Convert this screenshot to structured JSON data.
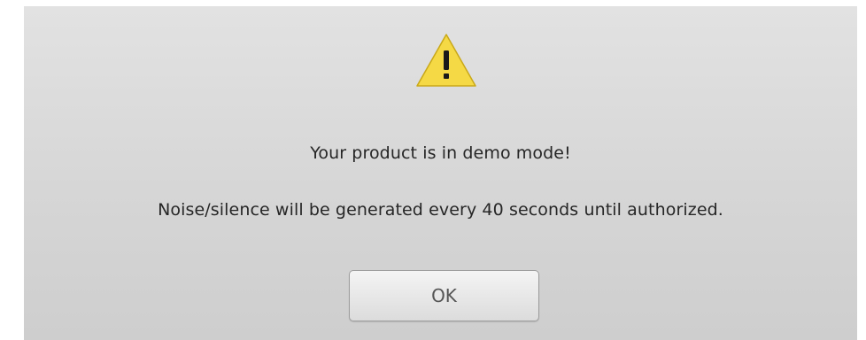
{
  "dialog": {
    "icon": "warning-icon",
    "title": "Your product is in demo mode!",
    "body": "Noise/silence will be generated every 40 seconds until authorized.",
    "ok_label": "OK"
  },
  "colors": {
    "dialog_background": "#d8d8d8",
    "warning_fill": "#f5d945",
    "warning_mark": "#1a1a1a",
    "text": "#262626"
  }
}
